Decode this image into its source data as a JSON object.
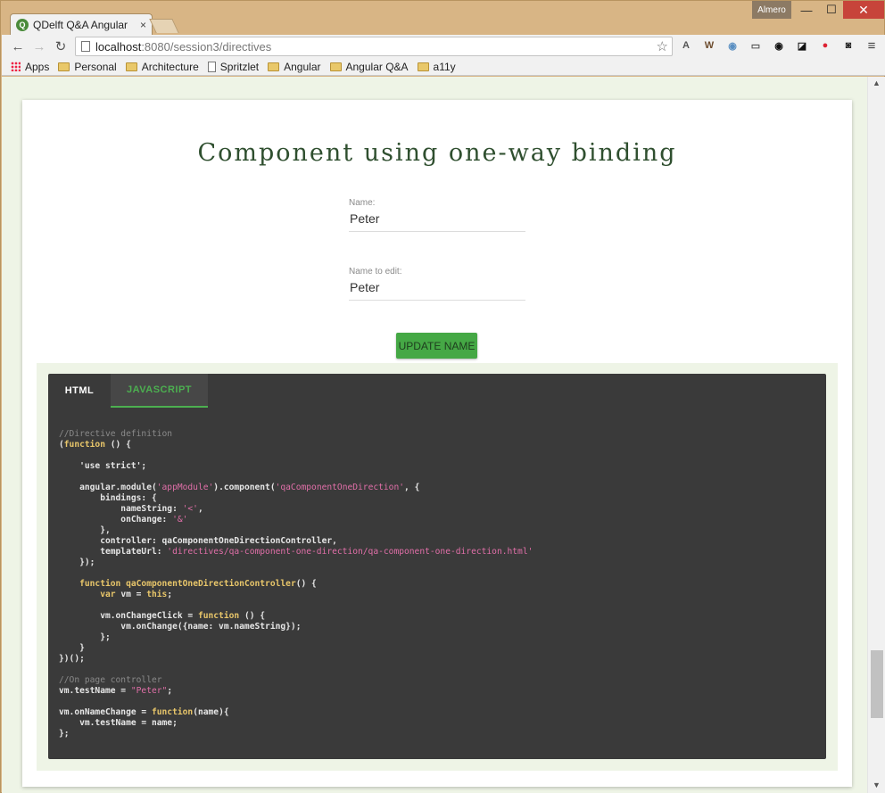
{
  "browser": {
    "tab_title": "QDelft Q&A Angular",
    "tab_close": "×",
    "favicon_letter": "Q",
    "profile_name": "Almero",
    "window_buttons": {
      "minimize": "—",
      "maximize": "☐",
      "close": "✕"
    },
    "nav": {
      "back": "←",
      "forward": "→",
      "reload": "↻"
    },
    "url_host": "localhost",
    "url_rest": ":8080/session3/directives",
    "bookmark_star": "☆",
    "extensions": [
      "A",
      "W",
      "◉",
      "▭",
      "◉",
      "◪",
      "●",
      "◙"
    ],
    "menu": "≡",
    "bookmarks": [
      {
        "label": "Apps",
        "type": "apps"
      },
      {
        "label": "Personal",
        "type": "folder"
      },
      {
        "label": "Architecture",
        "type": "folder"
      },
      {
        "label": "Spritzlet",
        "type": "page"
      },
      {
        "label": "Angular",
        "type": "folder"
      },
      {
        "label": "Angular Q&A",
        "type": "folder"
      },
      {
        "label": "a11y",
        "type": "folder"
      }
    ]
  },
  "page": {
    "heading": "Component using one-way binding",
    "name_label": "Name:",
    "name_value": "Peter",
    "edit_label": "Name to edit:",
    "edit_value": "Peter",
    "update_button": "UPDATE NAME",
    "tabs": {
      "html": "HTML",
      "javascript": "JAVASCRIPT"
    },
    "code_lines": [
      "//Directive definition",
      "(function () {",
      "",
      "    'use strict';",
      "",
      "    angular.module('appModule').component('qaComponentOneDirection', {",
      "        bindings: {",
      "            nameString: '<',",
      "            onChange: '&'",
      "        },",
      "        controller: qaComponentOneDirectionController,",
      "        templateUrl: 'directives/qa-component-one-direction/qa-component-one-direction.html'",
      "    });",
      "",
      "    function qaComponentOneDirectionController() {",
      "        var vm = this;",
      "",
      "        vm.onChangeClick = function () {",
      "            vm.onChange({name: vm.nameString});",
      "        };",
      "    }",
      "})();",
      "",
      "//On page controller",
      "vm.testName = \"Peter\";",
      "",
      "vm.onNameChange = function(name){",
      "    vm.testName = name;",
      "};"
    ]
  },
  "colors": {
    "accent_green": "#4caf50",
    "button_green": "#45a845",
    "code_bg": "#3a3a3a",
    "string_pink": "#e06fa8",
    "keyword_yellow": "#e8c66a",
    "comment_gray": "#8a8a8a"
  }
}
